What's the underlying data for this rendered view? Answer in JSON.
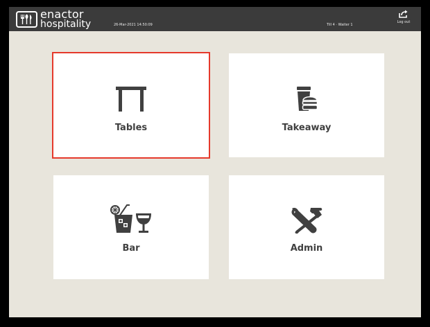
{
  "header": {
    "brand_line1": "enactor",
    "brand_line2": "hospitality",
    "datetime": "26-Mar-2021 14:50:09",
    "till_info": "Till 4 · Waiter 1",
    "logout_label": "Log out"
  },
  "tiles": [
    {
      "label": "Tables",
      "icon": "table-icon",
      "selected": true
    },
    {
      "label": "Takeaway",
      "icon": "takeaway-icon",
      "selected": false
    },
    {
      "label": "Bar",
      "icon": "bar-drinks-icon",
      "selected": false
    },
    {
      "label": "Admin",
      "icon": "admin-tools-icon",
      "selected": false
    }
  ],
  "colors": {
    "topbar": "#3b3b3b",
    "background": "#e8e5dc",
    "selection": "#e5392b",
    "icon": "#404040"
  }
}
